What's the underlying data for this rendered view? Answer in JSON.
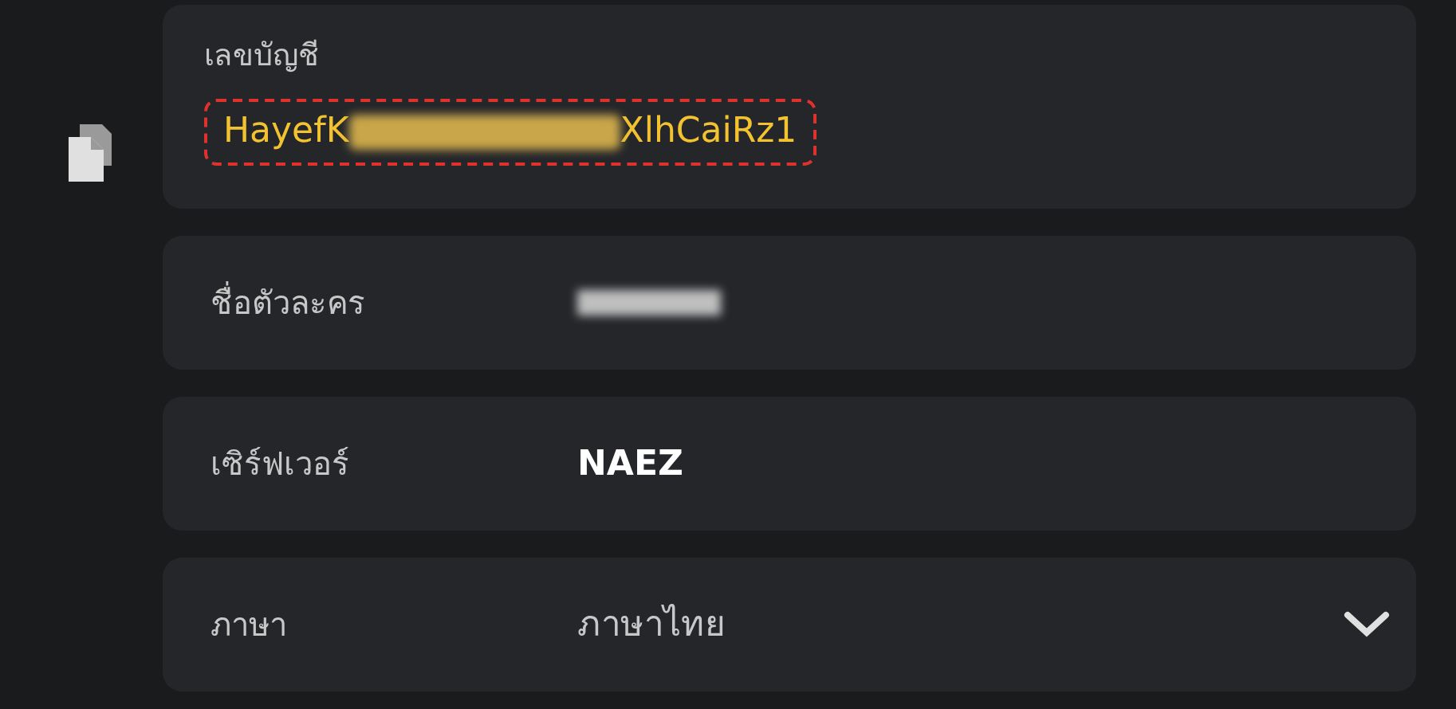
{
  "account": {
    "label": "เลขบัญชี",
    "value_start": "HayefK",
    "value_end": "XlhCaiRz1",
    "middle_redacted": true,
    "highlighted": true
  },
  "rows": [
    {
      "kind": "text",
      "label": "ชื่อตัวละคร",
      "redacted": true
    },
    {
      "kind": "text",
      "label": "เซิร์ฟเวอร์",
      "value": "NAEZ"
    },
    {
      "kind": "dropdown",
      "label": "ภาษา",
      "value": "ภาษาไทย"
    }
  ]
}
